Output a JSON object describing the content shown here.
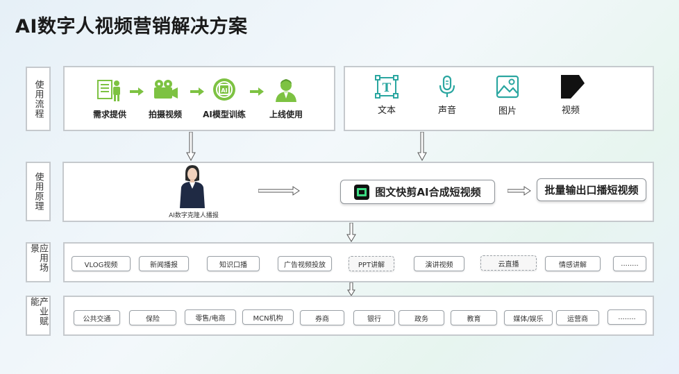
{
  "title": "AI数字人视频营销解决方案",
  "sections": {
    "process": "使用流程",
    "principle": "使用原理",
    "scenes": "应用场景",
    "industry": "产业赋能"
  },
  "process_steps": [
    {
      "label": "需求提供",
      "icon": "document-person-icon"
    },
    {
      "label": "拍摄视频",
      "icon": "video-camera-icon"
    },
    {
      "label": "AI模型训练",
      "icon": "ai-chip-icon"
    },
    {
      "label": "上线使用",
      "icon": "person-avatar-icon"
    }
  ],
  "media_types": [
    {
      "label": "文本",
      "icon": "text-icon"
    },
    {
      "label": "声音",
      "icon": "microphone-icon"
    },
    {
      "label": "图片",
      "icon": "image-icon"
    },
    {
      "label": "视频",
      "icon": "video-icon"
    }
  ],
  "principle": {
    "avatar_caption": "AI数字克隆人播报",
    "tool_label": "图文快剪AI合成短视频",
    "output_label": "批量输出口播短视频"
  },
  "scenes": [
    "VLOG视频",
    "新闻播报",
    "知识口播",
    "广告视频投放",
    "PPT讲解",
    "演讲视频",
    "云直播",
    "情感讲解",
    "........"
  ],
  "industries": [
    "公共交通",
    "保险",
    "零售/电商",
    "MCN机构",
    "券商",
    "银行",
    "政务",
    "教育",
    "媒体/娱乐",
    "运营商",
    "........"
  ],
  "colors": {
    "accent_green": "#7dc242",
    "teal": "#2aa6a0",
    "border": "#c5c9cd"
  }
}
